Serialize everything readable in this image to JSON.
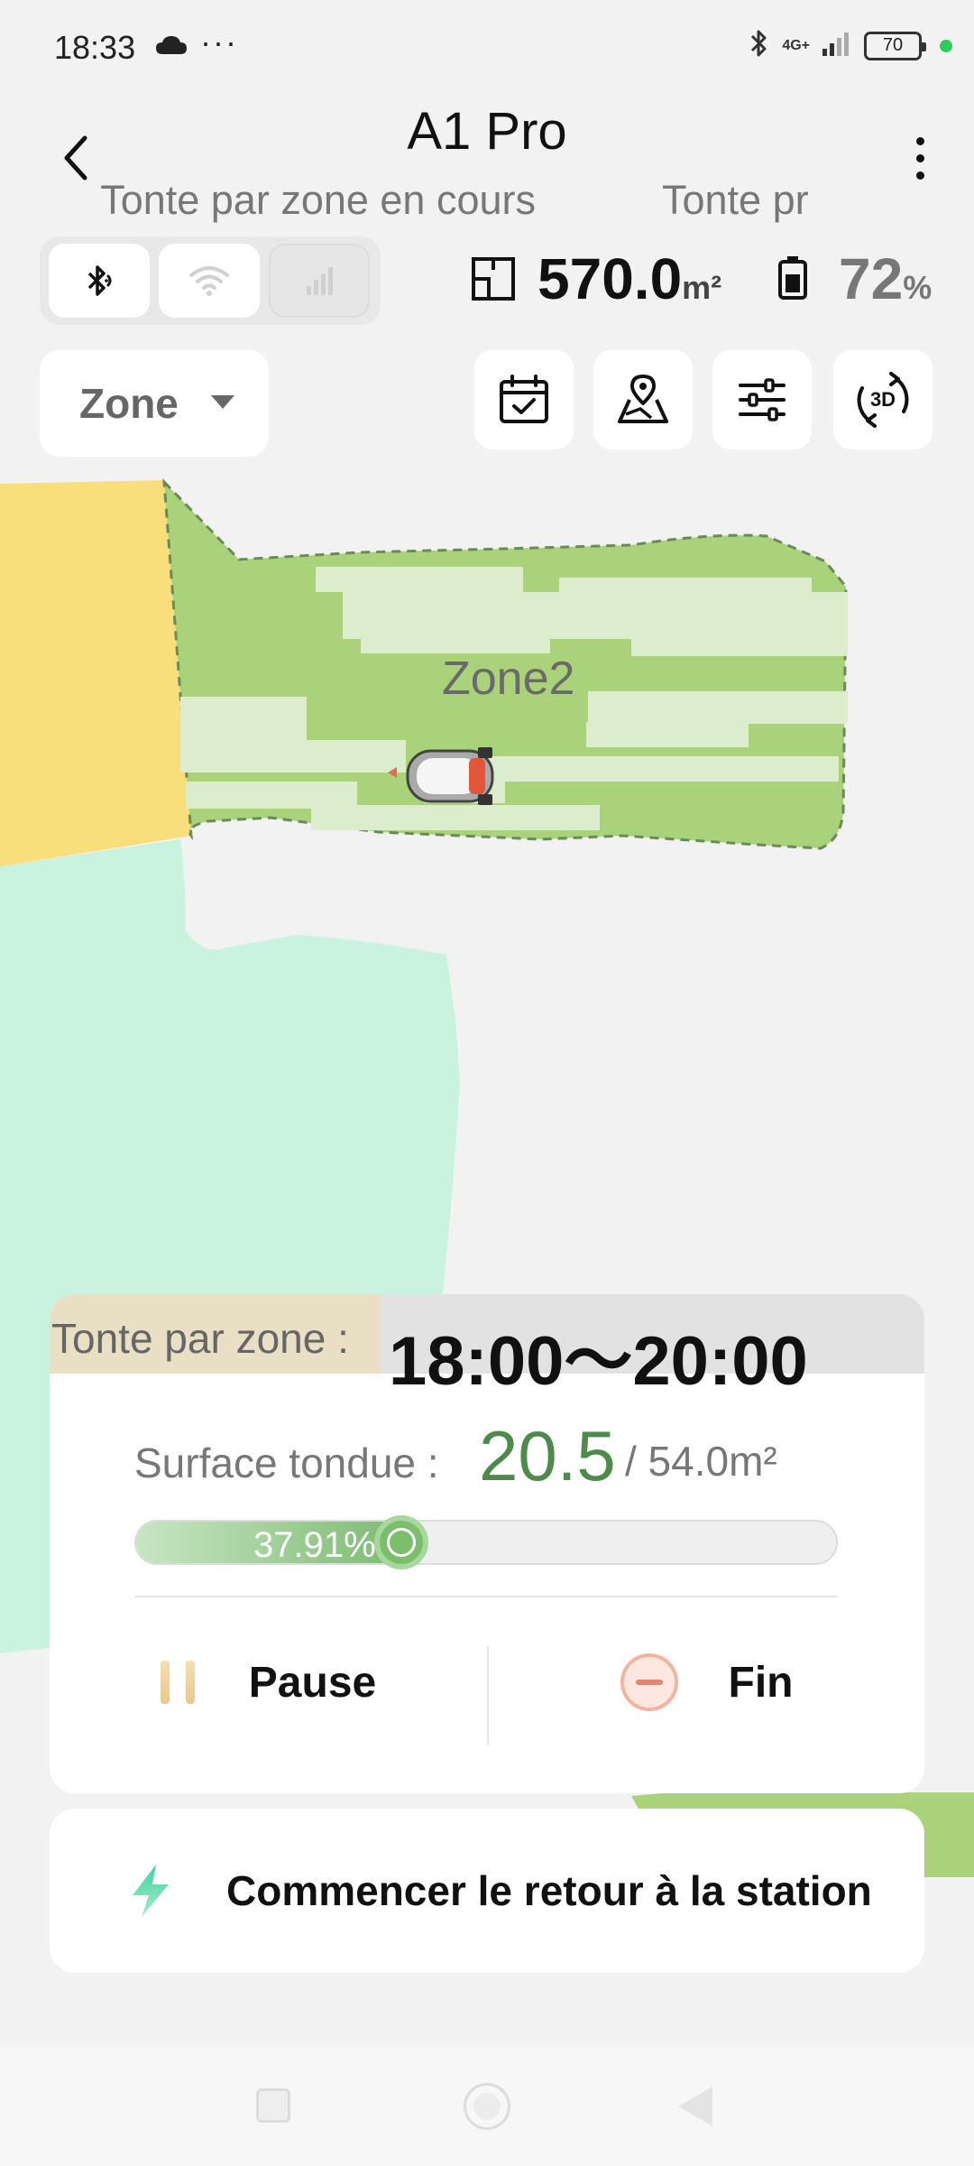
{
  "status_bar": {
    "time": "18:33",
    "icons": [
      "cloud-icon",
      "more-dots-icon",
      "bluetooth-icon",
      "signal-icon",
      "battery-icon"
    ],
    "dots": "···",
    "network": "4G+",
    "battery": "70",
    "dot_color": "#2ecc5a"
  },
  "header": {
    "title": "A1 Pro",
    "ticker_1": "Tonte par zone en cours",
    "ticker_2": "Tonte pr"
  },
  "connection": {
    "bluetooth": "active",
    "wifi": "available",
    "cellular": "inactive"
  },
  "stats": {
    "area_value": "570.0",
    "area_unit": "m²",
    "battery_value": "72",
    "battery_unit": "%"
  },
  "toolbar": {
    "zone_label": "Zone",
    "tools": [
      "calendar-check-icon",
      "map-pin-icon",
      "sliders-icon",
      "rotate-3d-icon"
    ],
    "view_3d_label": "3D"
  },
  "map": {
    "zone_name": "Zone2",
    "colors": {
      "active_zone": "#a9d27b",
      "mowed_strip": "#dcedcd",
      "yellow_zone": "#f8df7c",
      "mint_zone": "#c9f3de",
      "background": "#f2f2f2"
    }
  },
  "mowing_card": {
    "mode_label": "Tonte par zone :",
    "time_range": "18:00～20:00",
    "surface_label": "Surface tondue :",
    "surface_done": "20.5",
    "surface_total": "/ 54.0m²",
    "progress_text": "37.91%",
    "progress_fraction": 0.3791,
    "pause_label": "Pause",
    "fin_label": "Fin",
    "accent_color": "#4e8a4b"
  },
  "return_station": {
    "label": "Commencer le retour à la station"
  }
}
